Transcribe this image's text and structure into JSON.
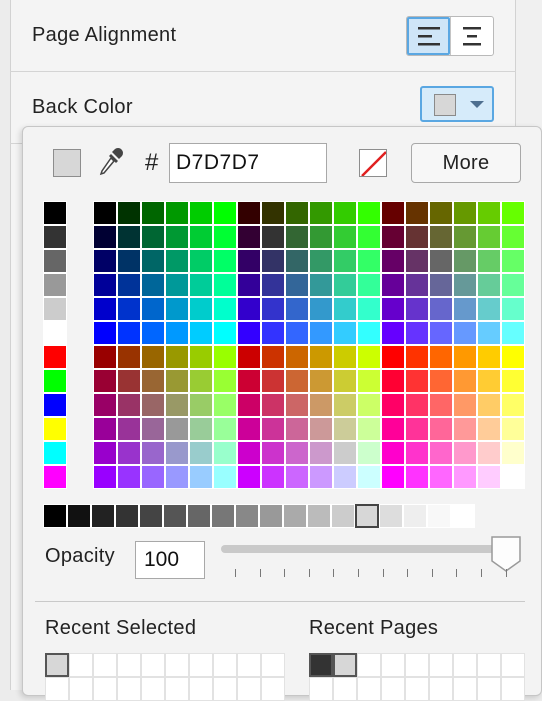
{
  "inspector": {
    "page_alignment_label": "Page Alignment",
    "back_color_label": "Back Color",
    "back_color_value": "#D7D7D7"
  },
  "picker": {
    "hash_symbol": "#",
    "hex_value": "D7D7D7",
    "more_label": "More",
    "opacity_label": "Opacity",
    "opacity_value": "100",
    "opacity_percent": 100,
    "recent_selected_label": "Recent Selected",
    "recent_pages_label": "Recent Pages",
    "recent_selected": [
      "#d7d7d7"
    ],
    "recent_pages": [
      "#333333",
      "#d7d7d7"
    ],
    "selected_gray": "#d7d7d7",
    "gray_column": [
      "#000000",
      "#333333",
      "#666666",
      "#999999",
      "#cccccc",
      "#ffffff",
      "#ff0000",
      "#00ff00",
      "#0000ff",
      "#ffff00",
      "#00ffff",
      "#ff00ff"
    ],
    "gray_ramp": [
      "#000000",
      "#111111",
      "#222222",
      "#333333",
      "#444444",
      "#555555",
      "#666666",
      "#777777",
      "#888888",
      "#999999",
      "#aaaaaa",
      "#bbbbbb",
      "#cccccc",
      "#d7d7d7",
      "#dddddd",
      "#eeeeee",
      "#f8f8f8",
      "#ffffff"
    ]
  },
  "icons": {
    "eyedropper": "eyedropper-icon",
    "no_color": "no-color-icon",
    "align_left": "align-left-icon",
    "align_center": "align-center-icon",
    "dropdown": "chevron-down-icon"
  }
}
